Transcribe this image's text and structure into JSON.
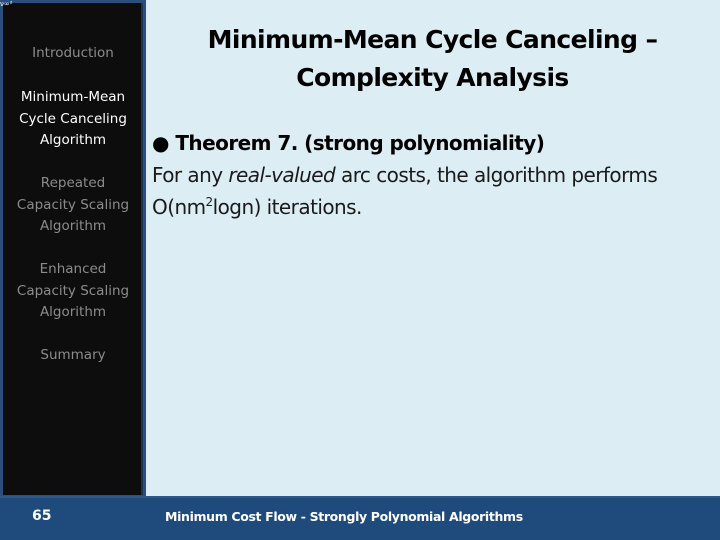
{
  "corner_mark": "ν∞²",
  "sidebar": {
    "items": [
      {
        "label": "Introduction",
        "active": false
      },
      {
        "label": "Minimum-Mean\nCycle Canceling\nAlgorithm",
        "active": true
      },
      {
        "label": "Repeated\nCapacity Scaling\nAlgorithm",
        "active": false
      },
      {
        "label": "Enhanced\nCapacity Scaling\nAlgorithm",
        "active": false
      },
      {
        "label": "Summary",
        "active": false
      }
    ]
  },
  "slide": {
    "title_line1": "Minimum-Mean Cycle Canceling –",
    "title_line2": "Complexity Analysis",
    "bullet_marker": "●",
    "theorem_heading": "Theorem 7. (strong polynomiality)",
    "body_prefix": "For any ",
    "body_emphasis": "real-valued",
    "body_suffix": " arc costs, the algorithm performs",
    "complexity_prefix": "O(nm",
    "complexity_exponent": "2",
    "complexity_suffix": "logn) iterations."
  },
  "footer": {
    "page_number": "65",
    "title": "Minimum Cost Flow - Strongly Polynomial Algorithms"
  },
  "colors": {
    "content_background": "#dcedf4",
    "sidebar_background": "#0d0d0d",
    "sidebar_frame": "#2b4e7e",
    "footer_background": "#1f4a7c",
    "nav_inactive": "#8c8c8c",
    "nav_active": "#ffffff"
  }
}
